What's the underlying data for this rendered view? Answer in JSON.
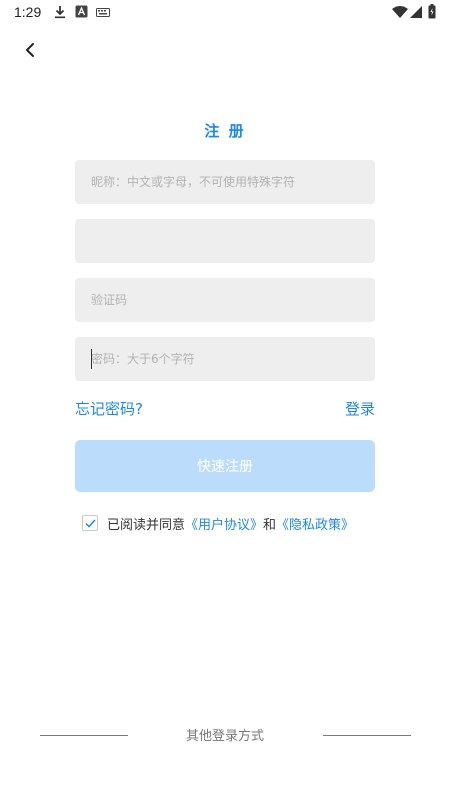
{
  "status_bar": {
    "time": "1:29",
    "icons": [
      "download-icon",
      "font-a-icon",
      "keyboard-icon",
      "wifi-icon",
      "signal-icon",
      "battery-icon"
    ]
  },
  "page": {
    "title": "注 册"
  },
  "form": {
    "nickname_placeholder": "昵称：中文或字母，不可使用特殊字符",
    "phone_value": "",
    "code_placeholder": "验证码",
    "password_placeholder": "密码：大于6个字符"
  },
  "links": {
    "forgot_password": "忘记密码?",
    "login": "登录"
  },
  "register_button": "快速注册",
  "agreement": {
    "checked": true,
    "prefix": "已阅读并同意",
    "user_agreement": "《用户协议》",
    "conjunction": "和",
    "privacy_policy": "《隐私政策》"
  },
  "other_login": {
    "label": "其他登录方式"
  },
  "colors": {
    "accent": "#1e88e5",
    "button_disabled": "#bcdcfb",
    "field_bg": "#eeeeee"
  }
}
